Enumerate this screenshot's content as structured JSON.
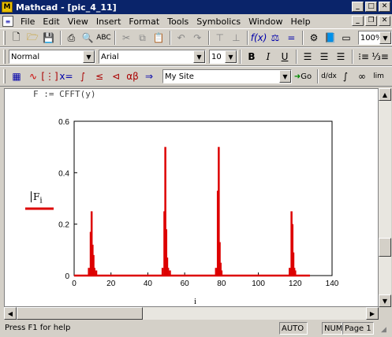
{
  "window": {
    "title": "Mathcad - [pic_4_11]"
  },
  "menu": [
    "File",
    "Edit",
    "View",
    "Insert",
    "Format",
    "Tools",
    "Symbolics",
    "Window",
    "Help"
  ],
  "toolbar_standard": {
    "zoom": "100%"
  },
  "toolbar_format": {
    "style": "Normal",
    "font": "Arial",
    "size": "10",
    "bold": "B",
    "italic": "I",
    "underline": "U"
  },
  "toolbar_math": {
    "resource": "My Site",
    "go": "Go"
  },
  "worksheet": {
    "equation": "F := CFFT(y)",
    "plot_y_label": "F",
    "plot_y_sub": "i",
    "plot_x_label": "i"
  },
  "status": {
    "help": "Press F1 for help",
    "mode": "AUTO",
    "num": "NUM",
    "page": "Page 1"
  },
  "colors": {
    "trace": "#dd0000",
    "titlebar": "#0a246a"
  },
  "chart_data": {
    "type": "line",
    "xlabel": "i",
    "ylabel": "Fi",
    "xlim": [
      0,
      140
    ],
    "ylim": [
      0,
      0.6
    ],
    "xticks": [
      "0",
      "20",
      "40",
      "60",
      "80",
      "100",
      "120",
      "140"
    ],
    "yticks": [
      "0",
      "0.2",
      "0.4",
      "0.6"
    ],
    "series": [
      {
        "x": [
          8,
          9,
          9.5,
          10,
          10.5,
          11,
          12,
          48,
          49,
          49.5,
          50,
          50.5,
          51,
          52,
          77,
          78,
          78.5,
          79,
          79.5,
          80,
          117,
          118,
          118.5,
          119,
          119.5,
          120
        ],
        "y": [
          0.03,
          0.17,
          0.25,
          0.12,
          0.08,
          0.03,
          0.02,
          0.03,
          0.25,
          0.5,
          0.18,
          0.07,
          0.03,
          0.02,
          0.03,
          0.33,
          0.5,
          0.13,
          0.05,
          0.02,
          0.03,
          0.25,
          0.2,
          0.09,
          0.03,
          0.02
        ]
      }
    ]
  }
}
